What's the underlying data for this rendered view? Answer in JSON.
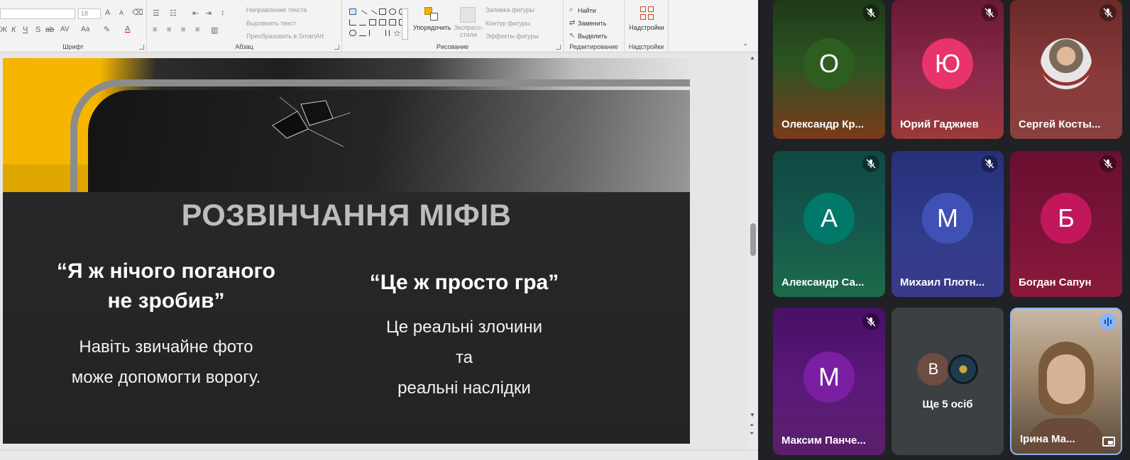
{
  "ribbon": {
    "font_size_value": "18",
    "text_direction": "Направление текста",
    "align_text": "Выровнять текст",
    "convert_smartart": "Преобразовать в SmartArt",
    "arrange": "Упорядочить",
    "quick_styles_line1": "Экспресс-",
    "quick_styles_line2": "стили",
    "shape_fill": "Заливка фигуры",
    "shape_outline": "Контур фигуры",
    "shape_effects": "Эффекты фигуры",
    "find": "Найти",
    "replace": "Заменить",
    "select": "Выделить",
    "addins": "Надстройки",
    "group_font": "Шрифт",
    "group_paragraph": "Абзац",
    "group_drawing": "Рисование",
    "group_editing": "Редактирование",
    "group_addins": "Надстройки",
    "bold_glyph": "Ж",
    "italic_glyph": "К",
    "underline_glyph": "Ч",
    "strike_glyph": "S",
    "spacing_glyph": "AV",
    "case_glyph": "Aa",
    "grow_glyph": "A",
    "shrink_glyph": "A"
  },
  "slide": {
    "title": "РОЗВІНЧАННЯ МІФІВ",
    "left_head_1": "“Я ж нічого поганого",
    "left_head_2": "не зробив”",
    "left_body_1": "Навіть звичайне фото",
    "left_body_2": "може допомогти ворогу.",
    "right_head": "“Це ж просто гра”",
    "right_body_1": "Це реальні злочини",
    "right_body_2": "та",
    "right_body_3": "реальні наслідки"
  },
  "participants": [
    {
      "initial": "О",
      "name": "Олександр Кр...",
      "avatar_color": "#2e5e1f",
      "muted": true
    },
    {
      "initial": "Ю",
      "name": "Юрий Гаджиев",
      "avatar_color": "#e8336b",
      "muted": true
    },
    {
      "initial": "",
      "name": "Сергей Косты...",
      "avatar_color": "#7a6a5a",
      "muted": true
    },
    {
      "initial": "А",
      "name": "Александр Са...",
      "avatar_color": "#00796b",
      "muted": true
    },
    {
      "initial": "М",
      "name": "Михаил Плотн...",
      "avatar_color": "#3f51b5",
      "muted": true
    },
    {
      "initial": "Б",
      "name": "Богдан Сапун",
      "avatar_color": "#c2185b",
      "muted": true
    },
    {
      "initial": "М",
      "name": "Максим Панче...",
      "avatar_color": "#7b1fa2",
      "muted": true
    },
    {
      "initial": "В",
      "name": "Ще 5 осіб",
      "avatar_color": "#6d4c41",
      "muted": false
    },
    {
      "initial": "",
      "name": "Ірина Ма...",
      "avatar_color": "#a67c52",
      "muted": false
    }
  ],
  "colors": {
    "meet_bg": "#202124",
    "tile_grey": "#3c4043",
    "speaking": "#8ab4f8"
  }
}
